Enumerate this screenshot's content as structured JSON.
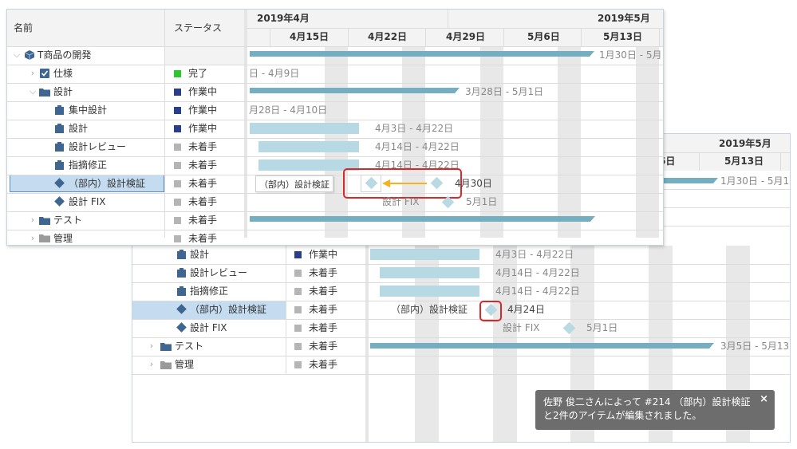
{
  "colors": {
    "done": "#2ec52e",
    "in_progress": "#2b3e8c",
    "not_started": "#b5b5b5",
    "highlight_red": "#d62a2a",
    "arrow": "#f5b21f"
  },
  "front": {
    "headers": {
      "name": "名前",
      "status": "ステータス"
    },
    "timeline": {
      "months": [
        "2019年4月",
        "2019年5月"
      ],
      "weeks": [
        "4月15日",
        "4月22日",
        "4月29日",
        "5月6日",
        "5月13日"
      ]
    },
    "rows": [
      {
        "name": "T商品の開発",
        "status": "",
        "icon": "cube-icon",
        "bar_label": "1月30日 - 5月"
      },
      {
        "name": "仕様",
        "status": "完了",
        "icon": "checkbox-icon",
        "bar_label": "日 - 4月9日"
      },
      {
        "name": "設計",
        "status": "作業中",
        "icon": "folder-icon",
        "bar_label": "3月28日 - 5月1日"
      },
      {
        "name": "集中設計",
        "status": "作業中",
        "icon": "task-icon",
        "bar_label": "月28日 - 4月10日"
      },
      {
        "name": "設計",
        "status": "作業中",
        "icon": "task-icon",
        "bar_label": "4月3日 - 4月22日"
      },
      {
        "name": "設計レビュー",
        "status": "未着手",
        "icon": "task-icon",
        "bar_label": "4月14日 - 4月22日"
      },
      {
        "name": "指摘修正",
        "status": "未着手",
        "icon": "task-icon",
        "bar_label": "4月14日 - 4月22日"
      },
      {
        "name": "（部内）設計検証",
        "status": "未着手",
        "icon": "milestone-icon",
        "bar_label": "4月30日"
      },
      {
        "name": "設計 FIX",
        "status": "未着手",
        "icon": "milestone-icon",
        "bar_label": "5月1日"
      },
      {
        "name": "テスト",
        "status": "未着手",
        "icon": "folder-icon",
        "bar_label": ""
      },
      {
        "name": "管理",
        "status": "未着手",
        "icon": "folder-gray-icon",
        "bar_label": ""
      }
    ],
    "drag_tooltip": "（部内）設計検証",
    "milestone_left_label": "設計 FIX"
  },
  "back": {
    "timeline": {
      "month": "2019年5月",
      "weeks": [
        "6日",
        "5月13日"
      ]
    },
    "summary_label": "1月30日 - 5月1",
    "rows": [
      {
        "name": "設計",
        "status": "作業中",
        "icon": "task-icon",
        "bar_label": "4月3日 - 4月22日"
      },
      {
        "name": "設計レビュー",
        "status": "未着手",
        "icon": "task-icon",
        "bar_label": "4月14日 - 4月22日"
      },
      {
        "name": "指摘修正",
        "status": "未着手",
        "icon": "task-icon",
        "bar_label": "4月14日 - 4月22日"
      },
      {
        "name": "（部内）設計検証",
        "status": "未着手",
        "icon": "milestone-icon",
        "bar_label": "4月24日",
        "left_label": "（部内）設計検証"
      },
      {
        "name": "設計 FIX",
        "status": "未着手",
        "icon": "milestone-icon",
        "bar_label": "5月1日",
        "left_label": "設計 FIX"
      },
      {
        "name": "テスト",
        "status": "未着手",
        "icon": "folder-icon",
        "bar_label": "3月5日 - 5月13"
      },
      {
        "name": "管理",
        "status": "未着手",
        "icon": "folder-gray-icon",
        "bar_label": ""
      }
    ]
  },
  "notification": {
    "line1": "佐野 俊二さんによって #214 （部内）設計検証",
    "line2": "と2件のアイテムが編集されました。",
    "close": "×"
  }
}
